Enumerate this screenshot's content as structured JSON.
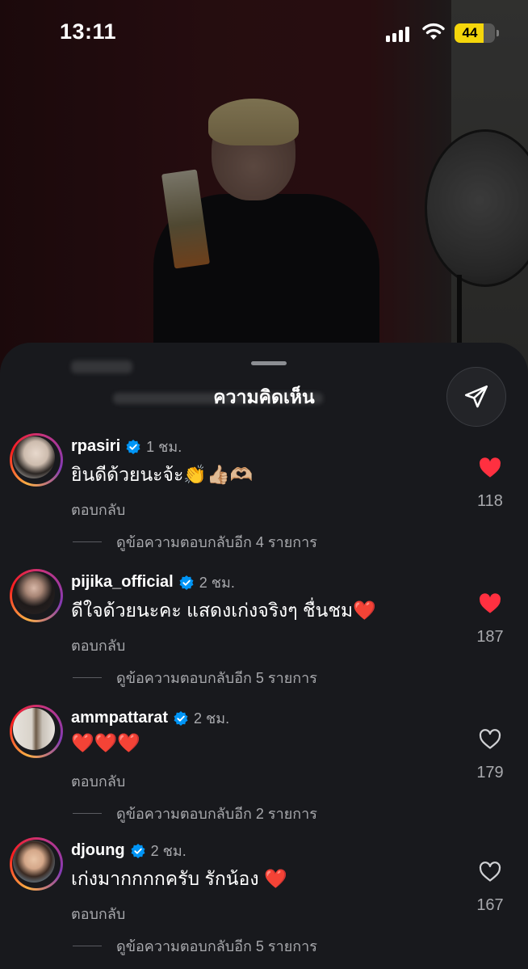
{
  "status_bar": {
    "time": "13:11",
    "battery": "44"
  },
  "sheet": {
    "title": "ความคิดเห็น"
  },
  "colors": {
    "like_red": "#ff3040",
    "verified_blue": "#0095f6",
    "battery_yellow": "#f5d60b"
  },
  "comments": [
    {
      "username": "rpasiri",
      "time": "1 ชม.",
      "text": "ยินดีด้วยนะจ้ะ👏👍🏼🫶🏼",
      "reply_label": "ตอบกลับ",
      "view_replies": "ดูข้อความตอบกลับอีก 4 รายการ",
      "likes": "118",
      "liked": true
    },
    {
      "username": "pijika_official",
      "time": "2 ชม.",
      "text": "ดีใจด้วยนะคะ แสดงเก่งจริงๆ ชื่นชม❤️",
      "reply_label": "ตอบกลับ",
      "view_replies": "ดูข้อความตอบกลับอีก 5 รายการ",
      "likes": "187",
      "liked": true
    },
    {
      "username": "ammpattarat",
      "time": "2 ชม.",
      "text": "❤️❤️❤️",
      "reply_label": "ตอบกลับ",
      "view_replies": "ดูข้อความตอบกลับอีก 2 รายการ",
      "likes": "179",
      "liked": false
    },
    {
      "username": "djoung",
      "time": "2 ชม.",
      "text": "เก่งมากกกกครับ รักน้อง ❤️",
      "reply_label": "ตอบกลับ",
      "view_replies": "ดูข้อความตอบกลับอีก 5 รายการ",
      "likes": "167",
      "liked": false
    }
  ]
}
